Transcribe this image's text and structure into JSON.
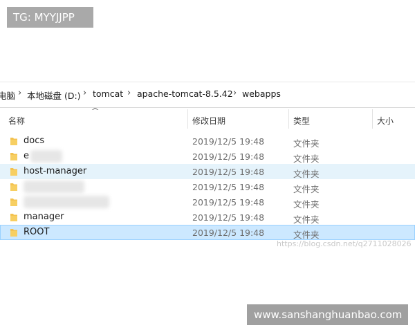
{
  "badges": {
    "tg": "TG: MYYJJPP",
    "site": "www.sanshanghuanbao.com"
  },
  "watermark": "https://blog.csdn.net/q2711028026",
  "breadcrumb": [
    "电脑",
    "本地磁盘 (D:)",
    "tomcat",
    "apache-tomcat-8.5.42",
    "webapps"
  ],
  "columns": {
    "name": "名称",
    "modified": "修改日期",
    "type": "类型",
    "size": "大小"
  },
  "rows": [
    {
      "name": "docs",
      "date": "2019/12/5 19:48",
      "type": "文件夹"
    },
    {
      "name": "e",
      "date": "2019/12/5 19:48",
      "type": "文件夹"
    },
    {
      "name": "host-manager",
      "date": "2019/12/5 19:48",
      "type": "文件夹"
    },
    {
      "name": "",
      "date": "2019/12/5 19:48",
      "type": "文件夹"
    },
    {
      "name": "",
      "date": "2019/12/5 19:48",
      "type": "文件夹"
    },
    {
      "name": "manager",
      "date": "2019/12/5 19:48",
      "type": "文件夹"
    },
    {
      "name": "ROOT",
      "date": "2019/12/5 19:48",
      "type": "文件夹"
    }
  ],
  "colors": {
    "folder": "#f3c24f",
    "hover_row": "#e5f3fb",
    "selected_row": "#cce8ff"
  }
}
